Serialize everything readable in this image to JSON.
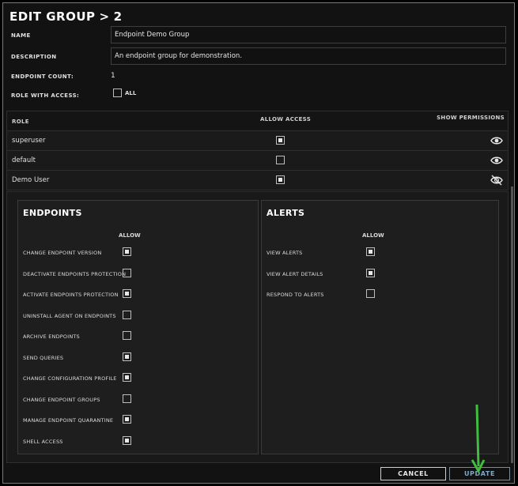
{
  "dialog": {
    "title": "EDIT GROUP",
    "title_sep": ">",
    "title_num": "2"
  },
  "form": {
    "name_label": "NAME",
    "name_value": "Endpoint Demo Group",
    "description_label": "DESCRIPTION",
    "description_value": "An endpoint group for demonstration.",
    "endpoint_count_label": "ENDPOINT COUNT:",
    "endpoint_count_value": "1",
    "role_access_label": "ROLE WITH ACCESS:",
    "all_label": "ALL",
    "all_checked": false
  },
  "roles_table": {
    "headers": {
      "role": "ROLE",
      "allow": "ALLOW ACCESS",
      "show": "SHOW PERMISSIONS"
    },
    "rows": [
      {
        "role": "superuser",
        "allow": true,
        "show_icon": "eye-icon"
      },
      {
        "role": "default",
        "allow": false,
        "show_icon": "eye-icon"
      },
      {
        "role": "Demo User",
        "allow": true,
        "show_icon": "eye-off-icon"
      }
    ]
  },
  "permissions": {
    "endpoints": {
      "title": "ENDPOINTS",
      "allow_header": "ALLOW",
      "items": [
        {
          "label": "CHANGE ENDPOINT VERSION",
          "checked": true
        },
        {
          "label": "DEACTIVATE ENDPOINTS PROTECTION",
          "checked": false
        },
        {
          "label": "ACTIVATE ENDPOINTS PROTECTION",
          "checked": true
        },
        {
          "label": "UNINSTALL AGENT ON ENDPOINTS",
          "checked": false
        },
        {
          "label": "ARCHIVE ENDPOINTS",
          "checked": false
        },
        {
          "label": "SEND QUERIES",
          "checked": true
        },
        {
          "label": "CHANGE CONFIGURATION PROFILE",
          "checked": true
        },
        {
          "label": "CHANGE ENDPOINT GROUPS",
          "checked": false
        },
        {
          "label": "MANAGE ENDPOINT QUARANTINE",
          "checked": true
        },
        {
          "label": "SHELL ACCESS",
          "checked": true
        }
      ]
    },
    "alerts": {
      "title": "ALERTS",
      "allow_header": "ALLOW",
      "items": [
        {
          "label": "VIEW ALERTS",
          "checked": true
        },
        {
          "label": "VIEW ALERT DETAILS",
          "checked": true
        },
        {
          "label": "RESPOND TO ALERTS",
          "checked": false
        }
      ]
    }
  },
  "footer": {
    "cancel_label": "CANCEL",
    "update_label": "UPDATE"
  },
  "colors": {
    "background": "#121212",
    "accent_update": "#7ea9c9",
    "annotation_arrow": "#3fbf3f"
  }
}
